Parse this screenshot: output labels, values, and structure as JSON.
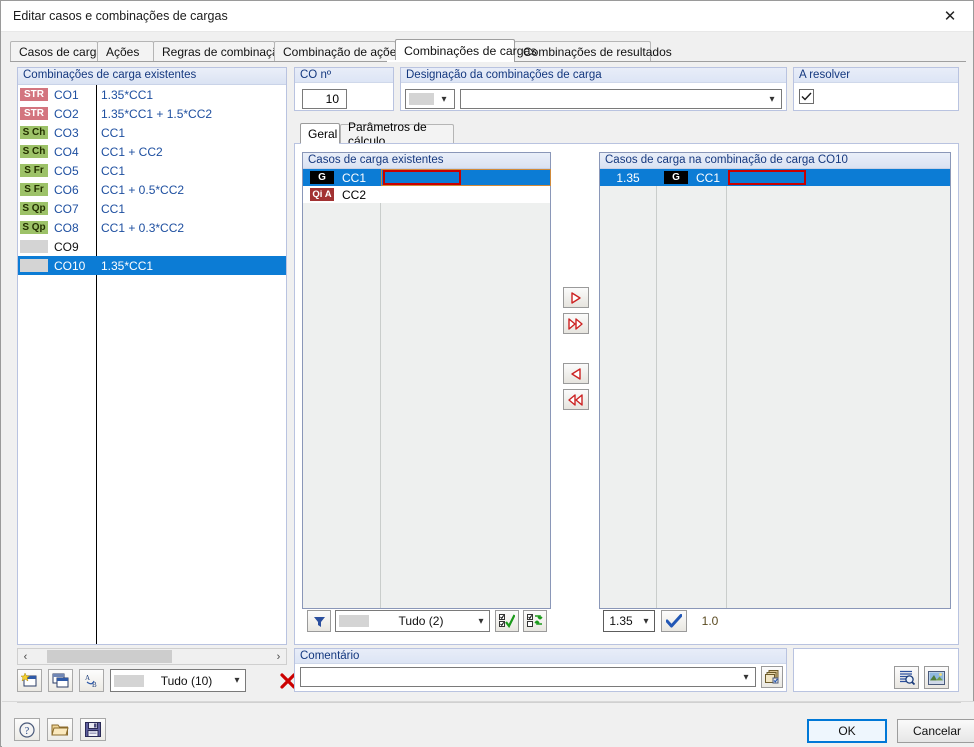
{
  "window": {
    "title": "Editar casos e combinações de cargas",
    "close_icon": "close-icon"
  },
  "tabs": [
    {
      "label": "Casos de carga",
      "active": false
    },
    {
      "label": "Ações",
      "active": false
    },
    {
      "label": "Regras de combinação",
      "active": false
    },
    {
      "label": "Combinação de ações",
      "active": false
    },
    {
      "label": "Combinações de cargas",
      "active": true
    },
    {
      "label": "Combinações de resultados",
      "active": false
    }
  ],
  "left_panel": {
    "title": "Combinações de carga existentes",
    "columns": [
      "",
      "no",
      "expression"
    ],
    "rows": [
      {
        "badge": "STR",
        "badge_type": "str",
        "name": "CO1",
        "expr": "1.35*CC1",
        "selected": false
      },
      {
        "badge": "STR",
        "badge_type": "str",
        "name": "CO2",
        "expr": "1.35*CC1 + 1.5*CC2",
        "selected": false
      },
      {
        "badge": "S Ch",
        "badge_type": "s",
        "name": "CO3",
        "expr": "CC1",
        "selected": false
      },
      {
        "badge": "S Ch",
        "badge_type": "s",
        "name": "CO4",
        "expr": "CC1 + CC2",
        "selected": false
      },
      {
        "badge": "S Fr",
        "badge_type": "s",
        "name": "CO5",
        "expr": "CC1",
        "selected": false
      },
      {
        "badge": "S Fr",
        "badge_type": "s",
        "name": "CO6",
        "expr": "CC1 + 0.5*CC2",
        "selected": false
      },
      {
        "badge": "S Qp",
        "badge_type": "s",
        "name": "CO7",
        "expr": "CC1",
        "selected": false
      },
      {
        "badge": "S Qp",
        "badge_type": "s",
        "name": "CO8",
        "expr": "CC1 + 0.3*CC2",
        "selected": false
      },
      {
        "badge": "",
        "badge_type": "none",
        "name": "CO9",
        "expr": "",
        "selected": false
      },
      {
        "badge": "",
        "badge_type": "none",
        "name": "CO10",
        "expr": "1.35*CC1",
        "selected": true
      }
    ],
    "scrollbar": {
      "left_arrow": "‹",
      "right_arrow": "›"
    },
    "toolbar": {
      "new_icon": "new-combination-icon",
      "copy_icon": "copy-combination-icon",
      "rename_icon": "rename-icon",
      "filter_value": "Tudo (10)",
      "filter_arrow": "chevron-down-icon",
      "delete_icon": "delete-icon"
    }
  },
  "co_number": {
    "title": "CO nº",
    "value": "10"
  },
  "designation": {
    "title": "Designação da combinações de carga",
    "selector_value": "",
    "selector_arrow": "chevron-down-icon",
    "text_value": "",
    "text_arrow": "chevron-down-icon"
  },
  "solve": {
    "title": "A resolver",
    "checked": true,
    "check_icon": "check-icon"
  },
  "inner_tabs": [
    {
      "label": "Geral",
      "active": true
    },
    {
      "label": "Parâmetros de cálculo",
      "active": false
    }
  ],
  "list_left": {
    "title": "Casos de carga existentes",
    "rows": [
      {
        "badge": "G",
        "badge_type": "g",
        "name": "CC1",
        "desc": "",
        "selected": true,
        "editing": true
      },
      {
        "badge": "Qi A",
        "badge_type": "qia",
        "name": "CC2",
        "desc": "",
        "selected": false,
        "editing": false
      }
    ],
    "footer": {
      "filter_icon": "funnel-icon",
      "filter_value": "Tudo (2)",
      "filter_arrow": "chevron-down-icon",
      "select_all_icon": "select-all-icon",
      "invert_selection_icon": "invert-selection-icon"
    }
  },
  "list_right": {
    "title": "Casos de carga na combinação de carga CO10",
    "rows": [
      {
        "factor": "1.35",
        "badge": "G",
        "badge_type": "g",
        "name": "CC1",
        "desc": "",
        "selected": true,
        "editing": true
      }
    ],
    "footer": {
      "factor_value": "1.35",
      "factor_arrow": "chevron-down-icon",
      "apply_icon": "check-icon",
      "unit_value": "1.0"
    }
  },
  "transfer_buttons": [
    {
      "name": "move-right-button",
      "glyph": "▶"
    },
    {
      "name": "move-all-right-button",
      "glyph": "▶▶"
    },
    {
      "name": "move-left-button",
      "glyph": "◀"
    },
    {
      "name": "move-all-left-button",
      "glyph": "◀◀"
    }
  ],
  "comment": {
    "title": "Comentário",
    "value": "",
    "arrow": "chevron-down-icon",
    "browse_icon": "copy-pages-icon"
  },
  "right_tools": {
    "inspect_icon": "magnifier-list-icon",
    "image_icon": "picture-icon"
  },
  "footer": {
    "help_icon": "help-icon",
    "open_icon": "open-folder-icon",
    "save_icon": "save-icon",
    "ok_label": "OK",
    "cancel_label": "Cancelar"
  },
  "colors": {
    "selection_blue": "#0c7cd5",
    "accent_red": "#c90000",
    "title_blue": "#16397f",
    "badge_str": "#d3757f",
    "badge_s": "#9dc268",
    "focus_blue": "#0078d7"
  }
}
